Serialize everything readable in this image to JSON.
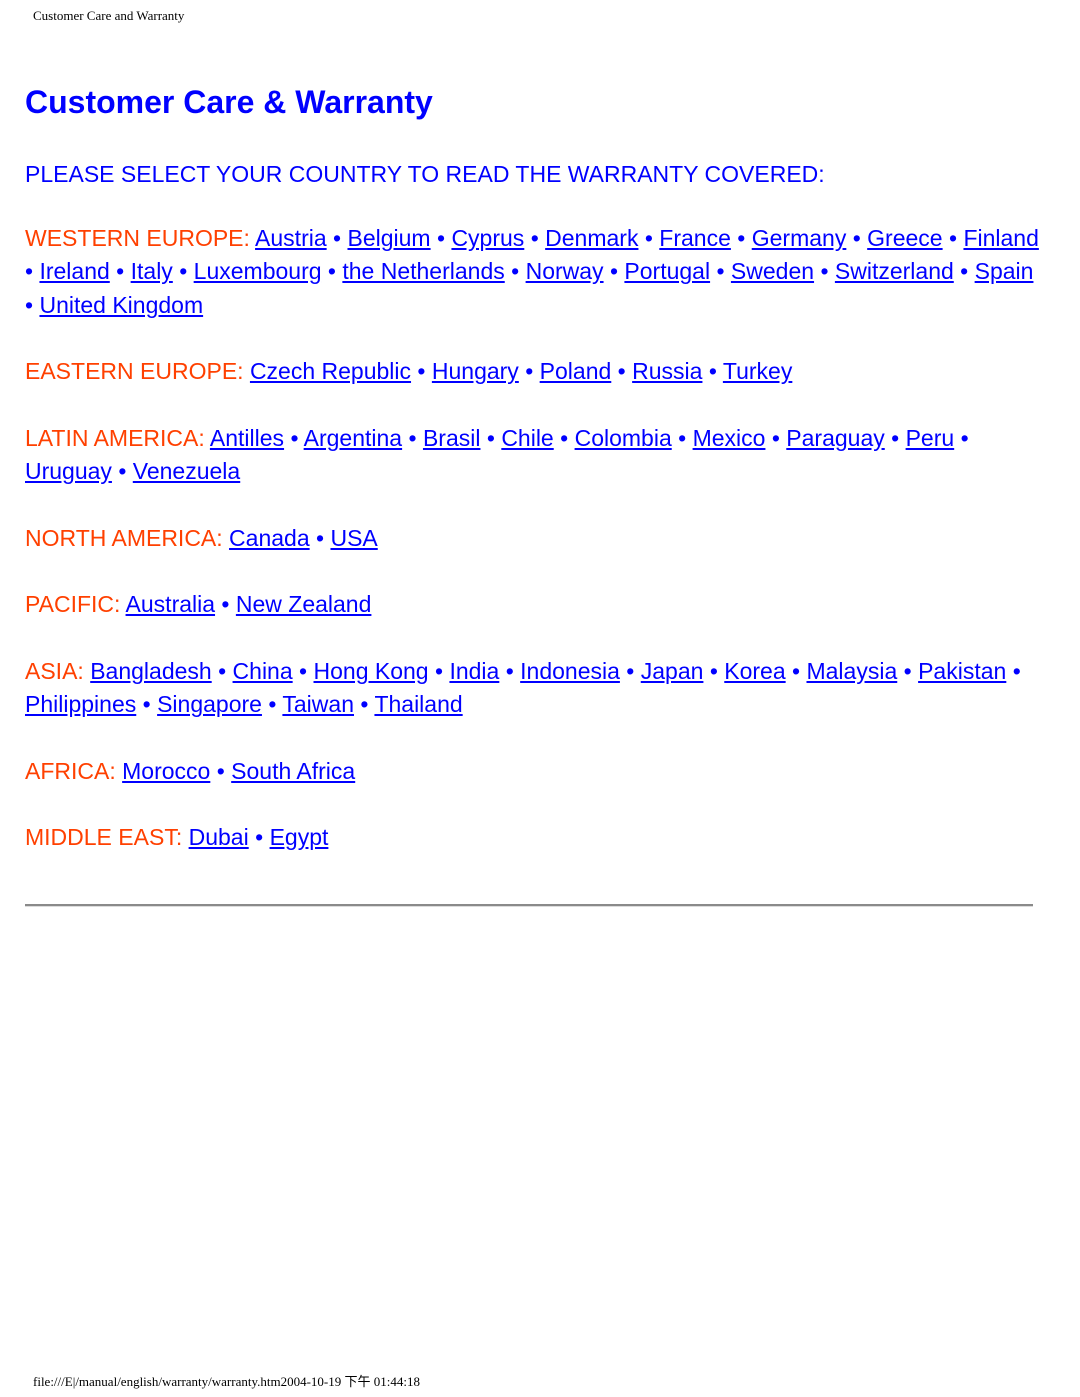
{
  "header": {
    "print_title": "Customer Care and Warranty"
  },
  "main": {
    "title": "Customer Care & Warranty",
    "intro": "PLEASE SELECT YOUR COUNTRY TO READ THE WARRANTY COVERED:",
    "separator": "•",
    "colors": {
      "title": "#0000ff",
      "link": "#0000ff",
      "region_label": "#ff4000"
    },
    "regions": [
      {
        "label": "WESTERN EUROPE:",
        "countries": [
          "Austria",
          "Belgium",
          "Cyprus",
          "Denmark",
          "France",
          "Germany",
          "Greece",
          "Finland",
          "Ireland",
          "Italy",
          "Luxembourg",
          "the Netherlands",
          "Norway",
          "Portugal",
          "Sweden",
          "Switzerland",
          "Spain",
          "United Kingdom"
        ]
      },
      {
        "label": "EASTERN EUROPE:",
        "countries": [
          "Czech Republic",
          "Hungary",
          "Poland",
          "Russia",
          "Turkey"
        ]
      },
      {
        "label": "LATIN AMERICA:",
        "countries": [
          "Antilles",
          "Argentina",
          "Brasil",
          "Chile",
          "Colombia",
          "Mexico",
          "Paraguay",
          "Peru",
          "Uruguay",
          "Venezuela"
        ]
      },
      {
        "label": "NORTH AMERICA:",
        "countries": [
          "Canada",
          "USA"
        ]
      },
      {
        "label": "PACIFIC:",
        "countries": [
          "Australia",
          "New Zealand"
        ]
      },
      {
        "label": "ASIA:",
        "countries": [
          "Bangladesh",
          "China",
          "Hong Kong",
          "India",
          "Indonesia",
          "Japan",
          "Korea",
          "Malaysia",
          "Pakistan",
          "Philippines",
          "Singapore",
          "Taiwan",
          "Thailand"
        ]
      },
      {
        "label": "AFRICA:",
        "countries": [
          "Morocco",
          "South Africa"
        ]
      },
      {
        "label": "MIDDLE EAST:",
        "countries": [
          "Dubai",
          "Egypt"
        ]
      }
    ]
  },
  "footer": {
    "print_footer": "file:///E|/manual/english/warranty/warranty.htm2004-10-19 下午 01:44:18"
  }
}
